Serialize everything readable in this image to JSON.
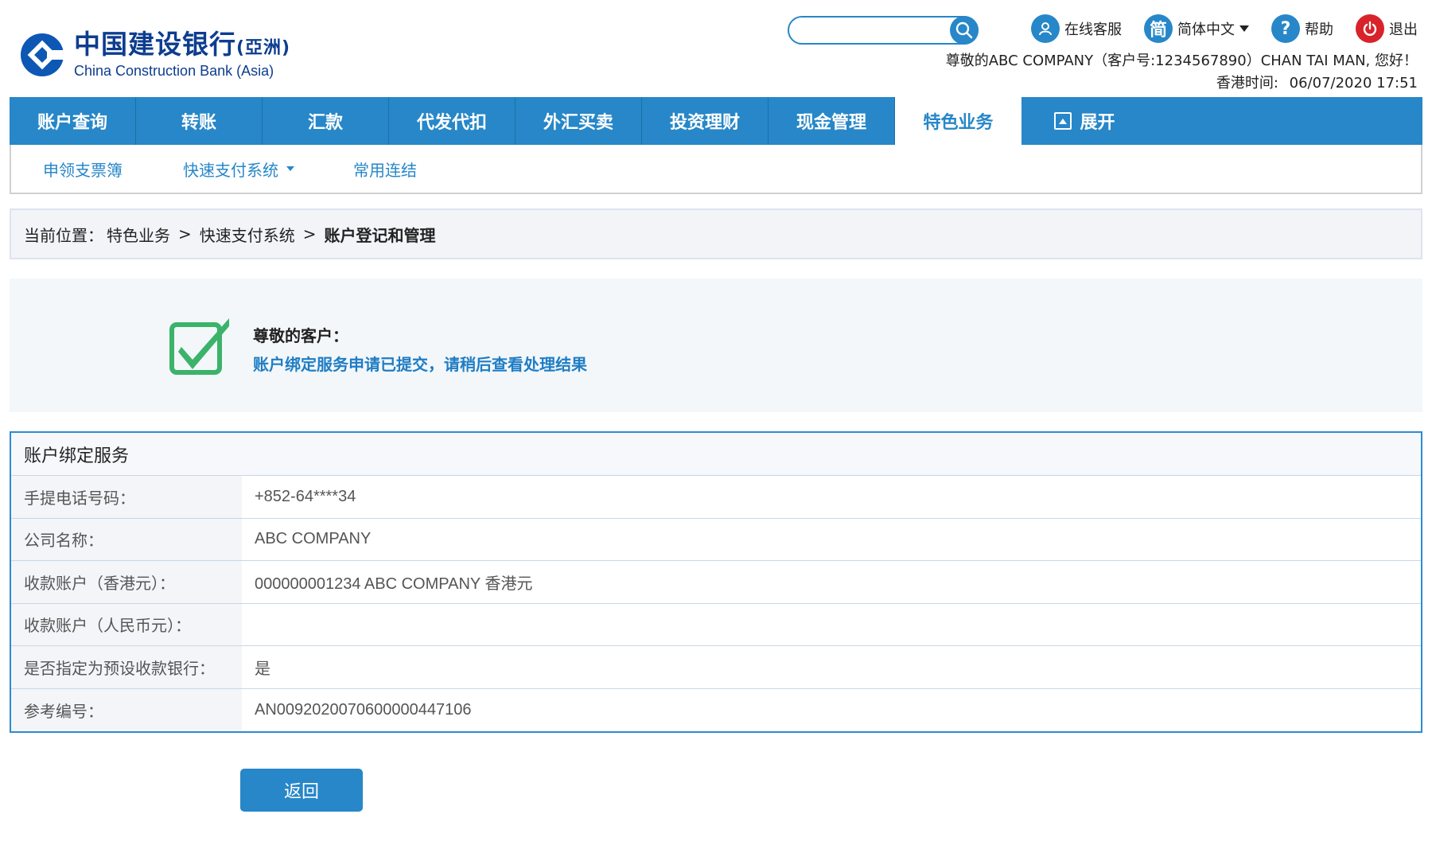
{
  "brand": {
    "name_cn": "中国建设银行",
    "name_cn_suffix": "(亞洲)",
    "name_en": "China Construction Bank (Asia)",
    "color": "#0d3d8f"
  },
  "search": {
    "placeholder": "",
    "value": ""
  },
  "top_links": [
    {
      "label": "在线客服",
      "icon": "user-support-icon"
    },
    {
      "label": "简体中文",
      "icon": "simplified-chinese-icon",
      "icon_text": "简"
    },
    {
      "label": "帮助",
      "icon": "help-icon",
      "icon_text": "?"
    },
    {
      "label": "退出",
      "icon": "power-icon"
    }
  ],
  "greeting": "尊敬的ABC COMPANY（客户号:1234567890）CHAN TAI MAN, 您好！",
  "hk_time": {
    "label": "香港时间:",
    "value": "06/07/2020 17:51"
  },
  "main_nav": {
    "items": [
      "账户查询",
      "转账",
      "汇款",
      "代发代扣",
      "外汇买卖",
      "投资理财",
      "现金管理",
      "特色业务"
    ],
    "active": "特色业务",
    "expand_label": "展开",
    "accent": "#2787c8"
  },
  "sub_nav": {
    "items": [
      "申领支票簿",
      "快速支付系统",
      "常用连结"
    ]
  },
  "breadcrumb": {
    "prefix": "当前位置：",
    "items": [
      "特色业务",
      "快速支付系统"
    ],
    "current": "账户登记和管理",
    "separator": ">"
  },
  "success": {
    "title": "尊敬的客户：",
    "message": "账户绑定服务申请已提交，请稍后查看处理结果",
    "icon": "checkbox-check-icon",
    "icon_color": "#3bb36a"
  },
  "info_table": {
    "title": "账户绑定服务",
    "rows": [
      {
        "label": "手提电话号码：",
        "value": "+852-64****34"
      },
      {
        "label": "公司名称：",
        "value": "ABC COMPANY"
      },
      {
        "label": "收款账户（香港元）：",
        "value": "000000001234 ABC COMPANY 香港元"
      },
      {
        "label": "收款账户（人民币元）：",
        "value": ""
      },
      {
        "label": "是否指定为预设收款银行：",
        "value": "是"
      },
      {
        "label": "参考编号：",
        "value": "AN0092020070600000447106"
      }
    ]
  },
  "buttons": {
    "back": "返回"
  }
}
